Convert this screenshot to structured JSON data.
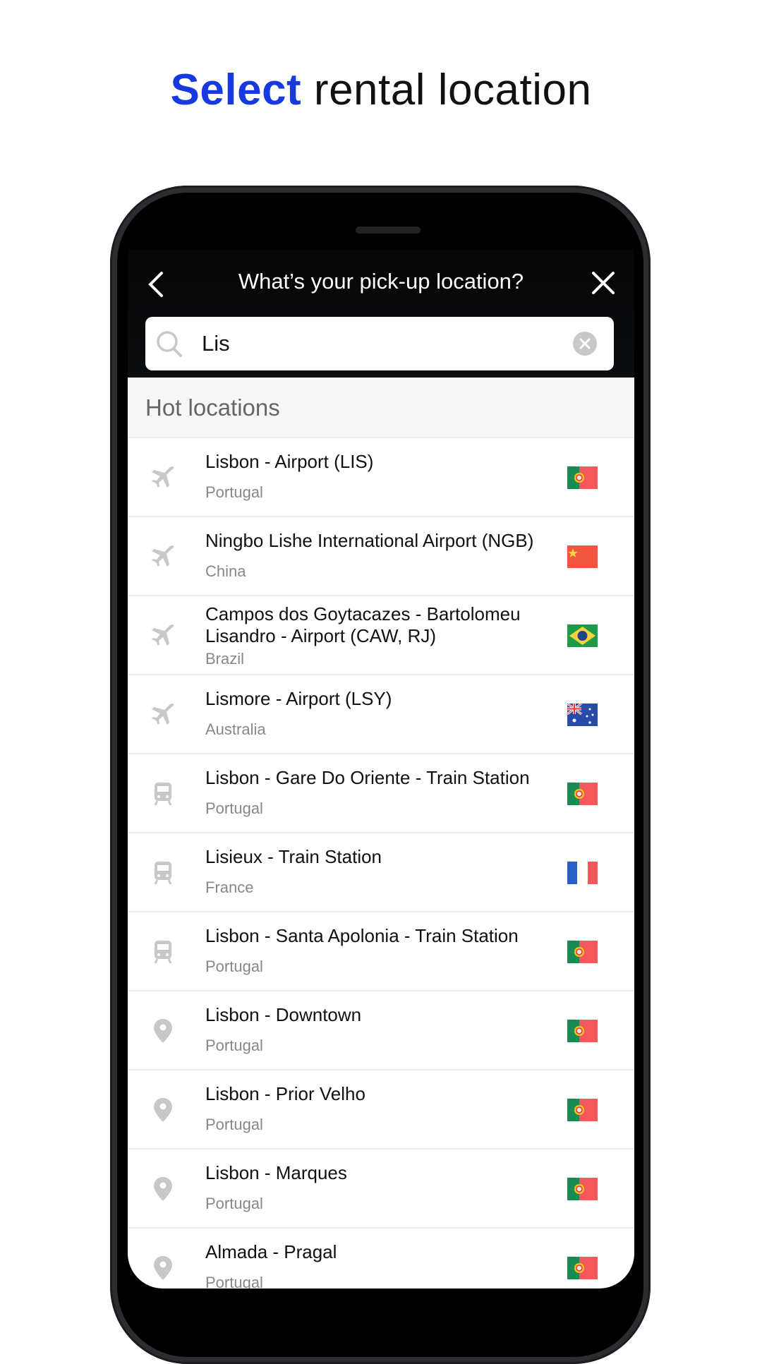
{
  "headline": {
    "accent": "Select",
    "rest": " rental location"
  },
  "colors": {
    "accent": "#1739e0",
    "icon_gray": "#c8c8c8"
  },
  "appbar": {
    "title": "What’s your pick-up location?",
    "back_icon": "chevron-left-icon",
    "close_icon": "close-icon"
  },
  "search": {
    "value": "Lis",
    "icon": "search-icon",
    "clear_icon": "clear-circle-icon"
  },
  "section": {
    "title": "Hot locations"
  },
  "locations": [
    {
      "name": "Lisbon - Airport (LIS)",
      "country": "Portugal",
      "type": "airport",
      "flag": "PT"
    },
    {
      "name": "Ningbo Lishe International Airport (NGB)",
      "country": "China",
      "type": "airport",
      "flag": "CN"
    },
    {
      "name": "Campos dos Goytacazes - Bartolomeu Lisandro - Airport (CAW, RJ)",
      "country": "Brazil",
      "type": "airport",
      "flag": "BR"
    },
    {
      "name": "Lismore - Airport (LSY)",
      "country": "Australia",
      "type": "airport",
      "flag": "AU"
    },
    {
      "name": "Lisbon - Gare Do Oriente - Train Station",
      "country": "Portugal",
      "type": "train",
      "flag": "PT"
    },
    {
      "name": "Lisieux - Train Station",
      "country": "France",
      "type": "train",
      "flag": "FR"
    },
    {
      "name": "Lisbon - Santa Apolonia - Train Station",
      "country": "Portugal",
      "type": "train",
      "flag": "PT"
    },
    {
      "name": "Lisbon - Downtown",
      "country": "Portugal",
      "type": "pin",
      "flag": "PT"
    },
    {
      "name": "Lisbon - Prior Velho",
      "country": "Portugal",
      "type": "pin",
      "flag": "PT"
    },
    {
      "name": "Lisbon - Marques",
      "country": "Portugal",
      "type": "pin",
      "flag": "PT"
    },
    {
      "name": "Almada - Pragal",
      "country": "Portugal",
      "type": "pin",
      "flag": "PT"
    }
  ]
}
